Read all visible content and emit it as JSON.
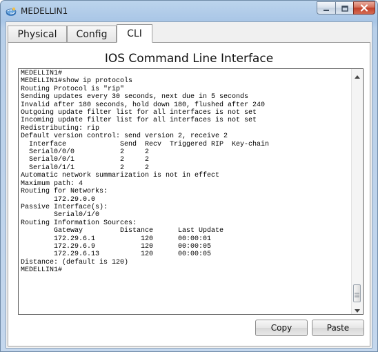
{
  "window": {
    "title": "MEDELLIN1"
  },
  "tabs": [
    {
      "label": "Physical"
    },
    {
      "label": "Config"
    },
    {
      "label": "CLI"
    }
  ],
  "active_tab": "CLI",
  "panel": {
    "title": "IOS Command Line Interface"
  },
  "terminal": {
    "text": "MEDELLIN1#\nMEDELLIN1#show ip protocols\nRouting Protocol is \"rip\"\nSending updates every 30 seconds, next due in 5 seconds\nInvalid after 180 seconds, hold down 180, flushed after 240\nOutgoing update filter list for all interfaces is not set\nIncoming update filter list for all interfaces is not set\nRedistributing: rip\nDefault version control: send version 2, receive 2\n  Interface             Send  Recv  Triggered RIP  Key-chain\n  Serial0/0/0           2     2\n  Serial0/0/1           2     2\n  Serial0/1/1           2     2\nAutomatic network summarization is not in effect\nMaximum path: 4\nRouting for Networks:\n        172.29.0.0\nPassive Interface(s):\n        Serial0/1/0\nRouting Information Sources:\n        Gateway         Distance      Last Update\n        172.29.6.1           120      00:00:01\n        172.29.6.9           120      00:00:05\n        172.29.6.13          120      00:00:05\nDistance: (default is 120)\nMEDELLIN1#"
  },
  "buttons": {
    "copy": "Copy",
    "paste": "Paste"
  },
  "icons": {
    "app": "router-app-icon",
    "minimize": "minimize-icon",
    "maximize": "maximize-icon",
    "close": "close-icon"
  },
  "colors": {
    "titlebar": "#bcd4ec",
    "close_button": "#c2412a",
    "terminal_bg": "#ffffff",
    "terminal_text": "#000000"
  }
}
